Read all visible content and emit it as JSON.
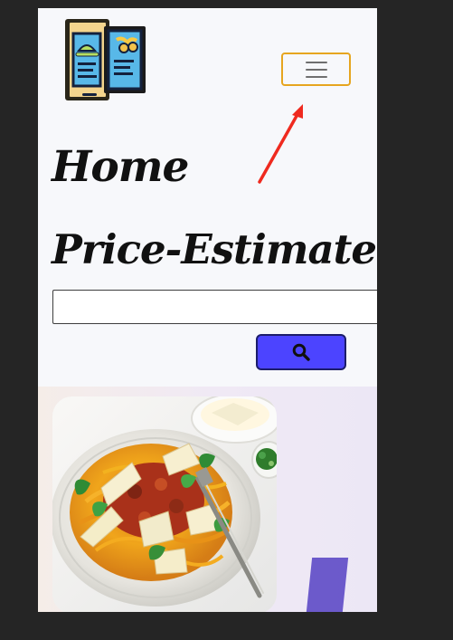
{
  "header": {
    "title_line_1": "Home",
    "title_line_2": "Price-Estimate",
    "logo_icon": "menu-book-logo-icon",
    "menu_icon": "hamburger-menu-icon",
    "annotation_arrow_color": "#ef2a1f",
    "menu_border_color": "#e6a51f"
  },
  "search": {
    "input_value": "",
    "placeholder": "",
    "button_icon": "search-icon",
    "button_color": "#4c44ff"
  },
  "content": {
    "image_name": "spaghetti-bolognese-photo"
  }
}
